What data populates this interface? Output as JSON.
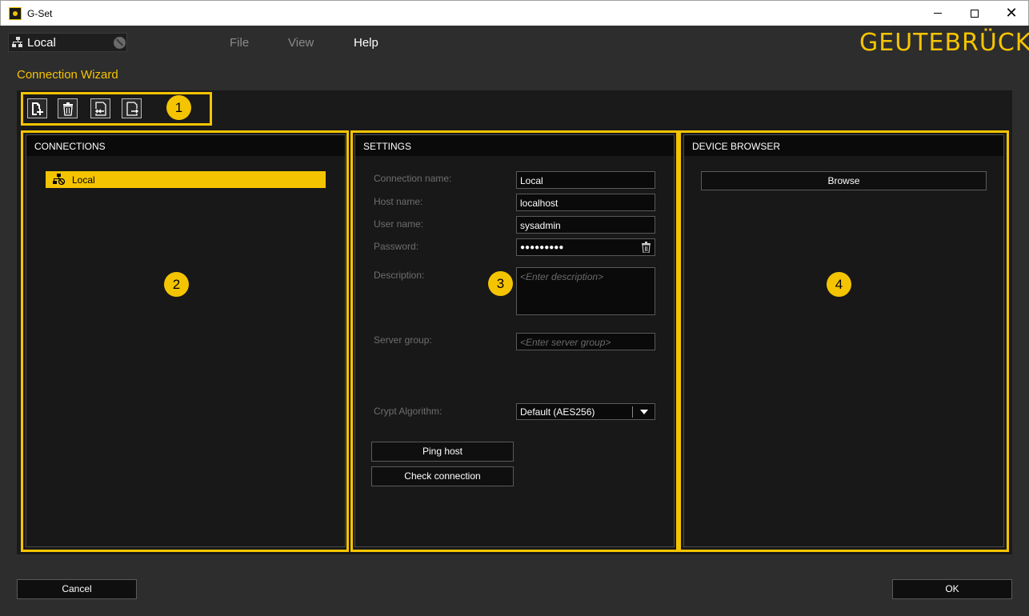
{
  "window": {
    "title": "G-Set",
    "minimize_label": "",
    "maximize_label": "",
    "close_label": "✕"
  },
  "header": {
    "connection_label": "Local",
    "menu": [
      "File",
      "View",
      "Help"
    ],
    "brand": "GEUTEBRÜCK"
  },
  "wizard_title": "Connection Wizard",
  "toolbar": {
    "icons": [
      "add-connection-icon",
      "delete-connection-icon",
      "import-icon",
      "export-icon"
    ]
  },
  "badges": [
    "1",
    "2",
    "3",
    "4"
  ],
  "connections": {
    "header": "CONNECTIONS",
    "items": [
      {
        "label": "Local",
        "icon": "network-icon",
        "selected": true
      }
    ]
  },
  "settings": {
    "header": "SETTINGS",
    "connection_name_label": "Connection name:",
    "connection_name": "Local",
    "host_name_label": "Host name:",
    "host_name": "localhost",
    "user_name_label": "User name:",
    "user_name": "sysadmin",
    "password_label": "Password:",
    "password": "●●●●●●●●●",
    "description_label": "Description:",
    "description_placeholder": "<Enter description>",
    "server_group_label": "Server group:",
    "server_group_placeholder": "<Enter server group>",
    "crypt_label": "Crypt Algorithm:",
    "crypt_value": "Default (AES256)",
    "ping_button": "Ping host",
    "check_button": "Check connection"
  },
  "device_browser": {
    "header": "DEVICE BROWSER",
    "browse_button": "Browse"
  },
  "footer": {
    "cancel": "Cancel",
    "ok": "OK"
  },
  "colors": {
    "accent": "#f5c400",
    "background": "#2d2d2d",
    "panel": "#181818"
  }
}
